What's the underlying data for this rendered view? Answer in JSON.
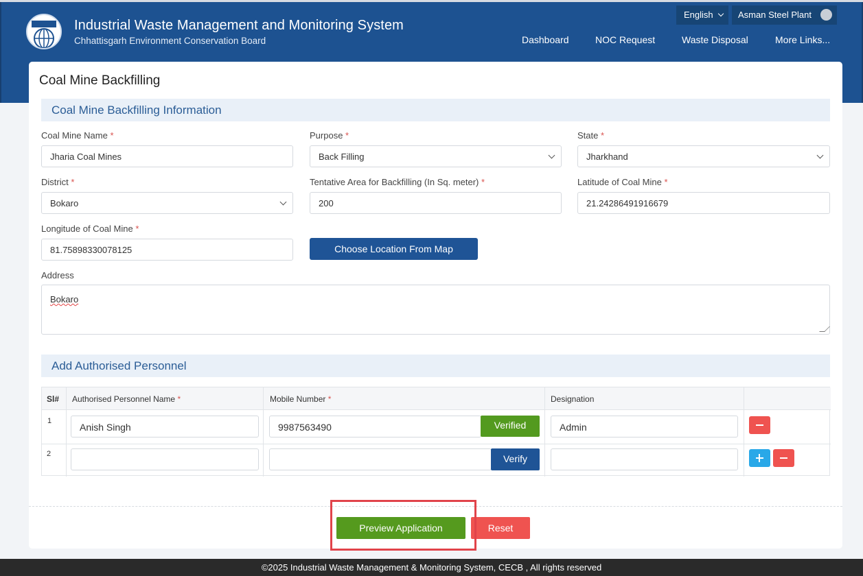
{
  "header": {
    "title": "Industrial Waste Management and Monitoring System",
    "subtitle": "Chhattisgarh Environment Conservation Board",
    "language": "English",
    "user_name": "Asman Steel Plant",
    "nav": [
      "Dashboard",
      "NOC Request",
      "Waste Disposal",
      "More Links..."
    ]
  },
  "page": {
    "title": "Coal Mine Backfilling"
  },
  "info_section": {
    "title": "Coal Mine Backfilling Information",
    "fields": {
      "coal_mine_name": {
        "label": "Coal Mine Name",
        "value": "Jharia Coal Mines"
      },
      "purpose": {
        "label": "Purpose",
        "value": "Back Filling"
      },
      "state": {
        "label": "State",
        "value": "Jharkhand"
      },
      "district": {
        "label": "District",
        "value": "Bokaro"
      },
      "tentative_area": {
        "label": "Tentative Area for Backfilling (In Sq. meter)",
        "value": "200"
      },
      "latitude": {
        "label": "Latitude of Coal Mine",
        "value": "21.24286491916679"
      },
      "longitude": {
        "label": "Longitude of Coal Mine",
        "value": "81.75898330078125"
      },
      "address": {
        "label": "Address",
        "value": "Bokaro"
      }
    },
    "map_button": "Choose Location From Map"
  },
  "personnel_section": {
    "title": "Add Authorised Personnel",
    "columns": [
      "Sl#",
      "Authorised Personnel Name",
      "Mobile Number",
      "Designation"
    ],
    "rows": [
      {
        "num": "1",
        "name": "Anish Singh",
        "mobile": "9987563490",
        "verify_label": "Verified",
        "designation": "Admin"
      },
      {
        "num": "2",
        "name": "",
        "mobile": "",
        "verify_label": "Verify",
        "designation": ""
      }
    ]
  },
  "actions": {
    "preview": "Preview Application",
    "reset": "Reset"
  },
  "footer": {
    "text": "©2025 Industrial Waste Management & Monitoring System, CECB , All rights reserved"
  },
  "colors": {
    "header_bg": "#1d5291",
    "primary_button": "#1f5496",
    "success_button": "#559a1e",
    "danger_button": "#ef5350",
    "add_button": "#29a8e8",
    "highlight_border": "#e1434a"
  },
  "icons": {
    "logo": "cecb-logo-icon",
    "language_caret": "chevron-down-icon",
    "user": "user-avatar-icon",
    "select_caret": "chevron-down-icon",
    "remove": "minus-icon",
    "add": "plus-icon"
  }
}
